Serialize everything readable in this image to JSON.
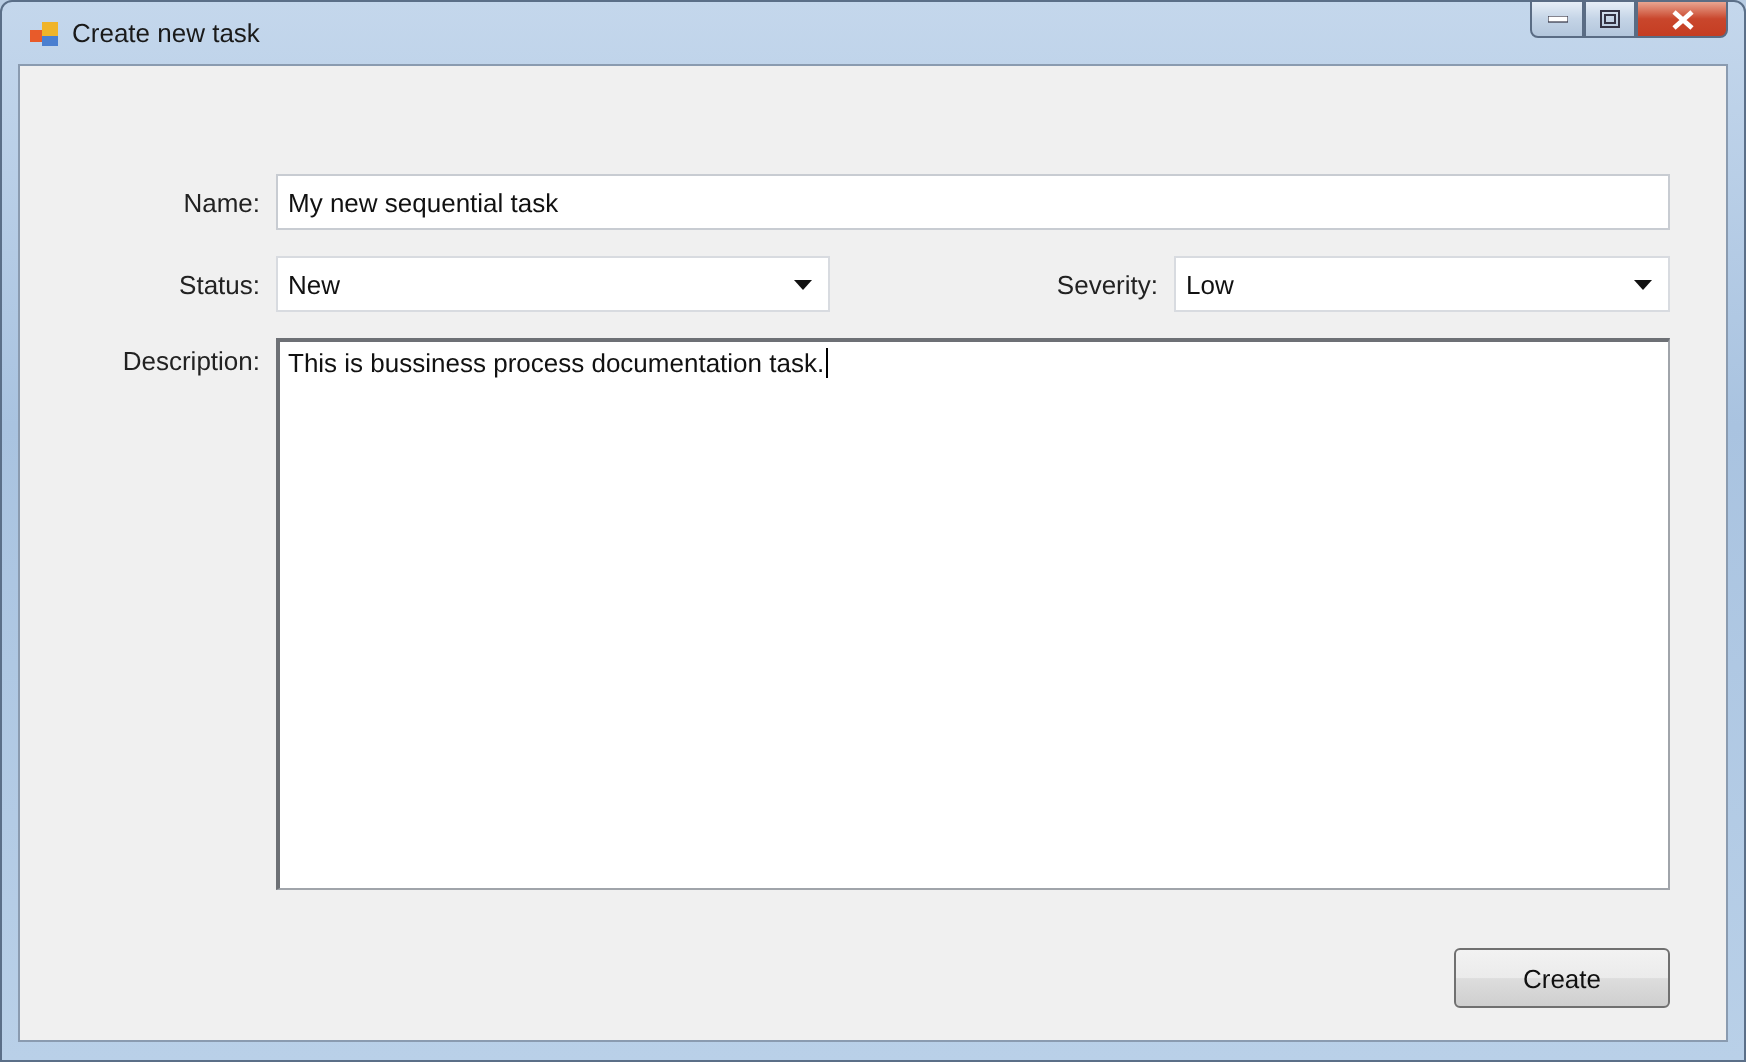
{
  "window": {
    "title": "Create new task"
  },
  "form": {
    "name": {
      "label": "Name:",
      "value": "My new sequential task"
    },
    "status": {
      "label": "Status:",
      "value": "New"
    },
    "severity": {
      "label": "Severity:",
      "value": "Low"
    },
    "description": {
      "label": "Description:",
      "value": "This is bussiness process documentation task."
    }
  },
  "buttons": [
    {
      "label": "Create"
    }
  ]
}
